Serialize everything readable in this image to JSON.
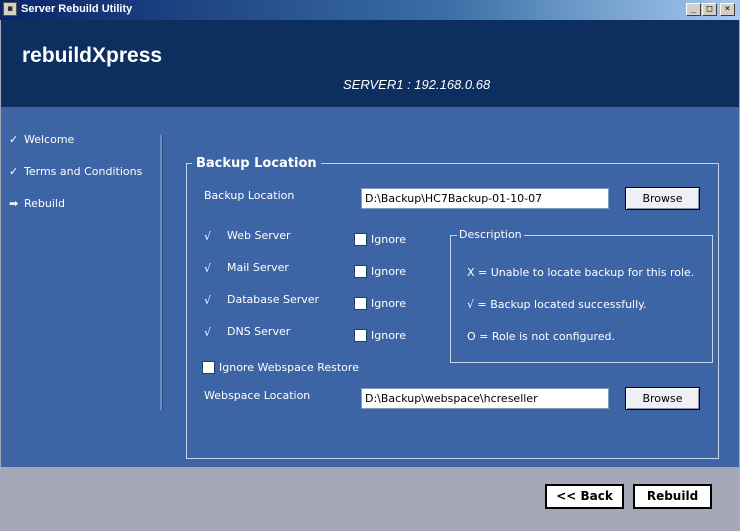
{
  "window": {
    "title": "Server Rebuild Utility",
    "controls": {
      "minimize": "_",
      "maximize": "□",
      "close": "×"
    }
  },
  "header": {
    "app_name": "rebuildXpress",
    "server_info": "SERVER1 : 192.168.0.68"
  },
  "steps": [
    {
      "label": "Welcome",
      "icon": "check-icon",
      "glyph": "✓"
    },
    {
      "label": "Terms and Conditions",
      "icon": "check-icon",
      "glyph": "✓"
    },
    {
      "label": "Rebuild",
      "icon": "arrow-right-icon",
      "glyph": "➡"
    }
  ],
  "backup": {
    "group_title": "Backup Location",
    "location_label": "Backup Location",
    "location_value": "D:\\Backup\\HC7Backup-01-10-07",
    "browse_label": "Browse"
  },
  "roles": [
    {
      "status": "√",
      "label": "Web Server",
      "ignore_label": "Ignore"
    },
    {
      "status": "√",
      "label": "Mail Server",
      "ignore_label": "Ignore"
    },
    {
      "status": "√",
      "label": "Database Server",
      "ignore_label": "Ignore"
    },
    {
      "status": "√",
      "label": "DNS Server",
      "ignore_label": "Ignore"
    }
  ],
  "description": {
    "title": "Description",
    "lines": [
      "X = Unable to locate backup for this role.",
      "√ = Backup located successfully.",
      "O = Role is not configured."
    ]
  },
  "webspace": {
    "ignore_label": "Ignore Webspace Restore",
    "location_label": "Webspace Location",
    "location_value": "D:\\Backup\\webspace\\hcreseller",
    "browse_label": "Browse"
  },
  "footer": {
    "back_label": "<< Back",
    "rebuild_label": "Rebuild"
  }
}
